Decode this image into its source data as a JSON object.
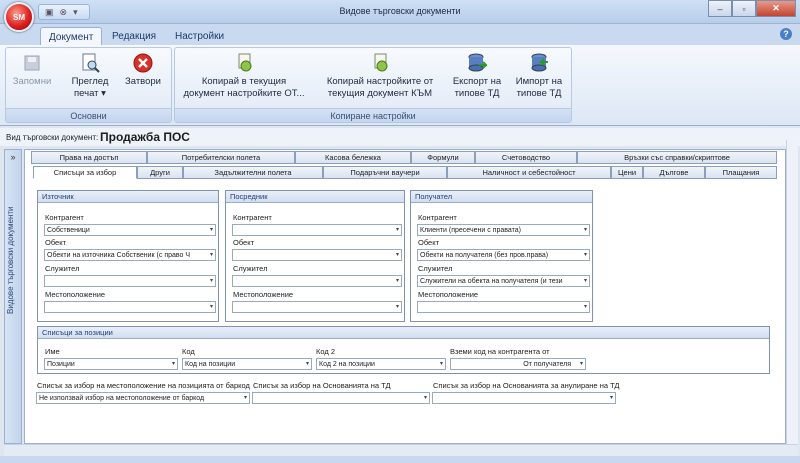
{
  "window": {
    "title": "Видове търговски документи",
    "orb": "SM"
  },
  "ribbon_tabs": [
    "Документ",
    "Редакция",
    "Настройки"
  ],
  "ribbon": {
    "groups": {
      "basic": "Основни",
      "copy": "Копиране настройки"
    },
    "buttons": {
      "save": "Запомни",
      "preview1": "Преглед",
      "preview2": "печат",
      "close": "Затвори",
      "copy_to1": "Копирай в текущия",
      "copy_to2": "документ настройките ОТ...",
      "copy_from1": "Копирай настройките от",
      "copy_from2": "текущия документ КЪМ",
      "export1": "Експорт на",
      "export2": "типове ТД",
      "import1": "Импорт на",
      "import2": "типове ТД"
    }
  },
  "doc_type": {
    "label": "Вид търговски документ:",
    "value": "Продажба ПОС"
  },
  "sidebar": {
    "label": "Видове търговски документи",
    "toggle": "»"
  },
  "tabs_row1": [
    "Права на достъп",
    "Потребителски полета",
    "Касова бележка",
    "Формули",
    "Счетоводство",
    "Връзки със справки/скриптове"
  ],
  "tabs_row2": [
    "Списъци за избор",
    "Други",
    "Задължителни полета",
    "Подаръчни ваучери",
    "Наличност и себестойност",
    "Цени",
    "Дългове",
    "Плащания"
  ],
  "source": {
    "title": "Източник",
    "l_partner": "Контрагент",
    "v_partner": "Собственици",
    "l_object": "Обект",
    "v_object": "Обекти на източника Собственик (с право Ч",
    "l_employee": "Служител",
    "v_employee": "",
    "l_location": "Местоположение",
    "v_location": ""
  },
  "mediator": {
    "title": "Посредник",
    "l_partner": "Контрагент",
    "v_partner": "",
    "l_object": "Обект",
    "v_object": "",
    "l_employee": "Служител",
    "v_employee": "",
    "l_location": "Местоположение",
    "v_location": ""
  },
  "receiver": {
    "title": "Получател",
    "l_partner": "Контрагент",
    "v_partner": "Клиенти (пресечени с правата)",
    "l_object": "Обект",
    "v_object": "Обекти на получателя (без пров.права)",
    "l_employee": "Служител",
    "v_employee": "Служители на обекта на получателя (и тези",
    "l_location": "Местоположение",
    "v_location": ""
  },
  "positions": {
    "title": "Списъци за позиции",
    "l_name": "Име",
    "v_name": "Позиции",
    "l_code": "Код",
    "v_code": "Код на позиции",
    "l_code2": "Код 2",
    "v_code2": "Код 2 на позиции",
    "l_take": "Вземи код на контрагента от",
    "v_take": "От получателя"
  },
  "bottom": {
    "l_barcode": "Списък за избор на местоположение на позицията от баркод",
    "v_barcode": "Не използвай избор на местоположение от баркод",
    "l_reasons": "Списък за избор на Основанията на ТД",
    "v_reasons": "",
    "l_cancel": "Списък за избор на Основанията за анулиране на ТД",
    "v_cancel": ""
  }
}
